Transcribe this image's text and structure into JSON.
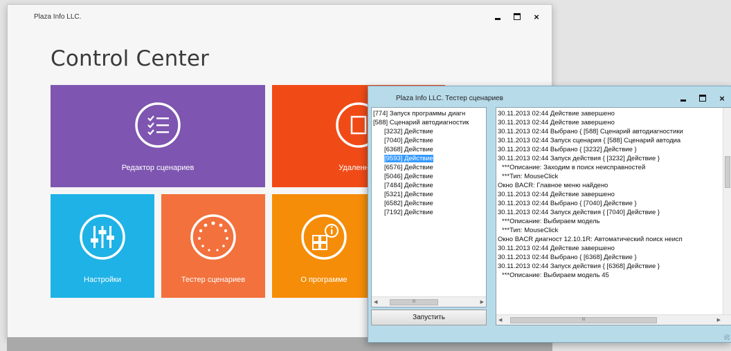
{
  "main_window": {
    "title": "Plaza Info LLC.",
    "app_title": "Control Center",
    "tiles": [
      {
        "id": "editor",
        "label": "Редактор сценариев",
        "color": "#7e55b0"
      },
      {
        "id": "remote",
        "label": "Удаленный",
        "color": "#f04b17"
      },
      {
        "id": "settings",
        "label": "Настройки",
        "color": "#1fb2e6"
      },
      {
        "id": "tester",
        "label": "Тестер сценариев",
        "color": "#f2713c"
      },
      {
        "id": "about",
        "label": "О программе",
        "color": "#f58d09"
      }
    ],
    "controls": {
      "close": "×"
    }
  },
  "tester_window": {
    "title": "Plaza Info LLC. Тестер сценариев",
    "controls": {
      "close": "×"
    },
    "tree": [
      {
        "text": "[774] Запуск программы диагн",
        "child": false,
        "selected": false
      },
      {
        "text": "[588] Сценарий автодиагностик",
        "child": false,
        "selected": false
      },
      {
        "text": "[3232] Действие",
        "child": true,
        "selected": false
      },
      {
        "text": "[7040] Действие",
        "child": true,
        "selected": false
      },
      {
        "text": "[6368] Действие",
        "child": true,
        "selected": false
      },
      {
        "text": "[9593] Действие",
        "child": true,
        "selected": true
      },
      {
        "text": "[6576] Действие",
        "child": true,
        "selected": false
      },
      {
        "text": "[5046] Действие",
        "child": true,
        "selected": false
      },
      {
        "text": "[7484] Действие",
        "child": true,
        "selected": false
      },
      {
        "text": "[5321] Действие",
        "child": true,
        "selected": false
      },
      {
        "text": "[6582] Действие",
        "child": true,
        "selected": false
      },
      {
        "text": "[7192] Действие",
        "child": true,
        "selected": false
      }
    ],
    "run_button": "Запустить",
    "log": [
      {
        "text": "30.11.2013 02:44 Действие завершено",
        "indent": false
      },
      {
        "text": "30.11.2013 02:44 Действие завершено",
        "indent": false
      },
      {
        "text": "30.11.2013 02:44 Выбрано { [588] Сценарий автодиагностики",
        "indent": false
      },
      {
        "text": "30.11.2013 02:44 Запуск сценария { [588] Сценарий автодиа",
        "indent": false
      },
      {
        "text": "30.11.2013 02:44 Выбрано { [3232] Действие }",
        "indent": false
      },
      {
        "text": "30.11.2013 02:44 Запуск действия { [3232] Действие }",
        "indent": false
      },
      {
        "text": "***Описание: Заходим в поиск неисправностей",
        "indent": true
      },
      {
        "text": "***Тип: MouseClick",
        "indent": true
      },
      {
        "text": "Окно BACR:  Главное меню найдено",
        "indent": false
      },
      {
        "text": "30.11.2013 02:44 Действие завершено",
        "indent": false
      },
      {
        "text": "30.11.2013 02:44 Выбрано { [7040] Действие }",
        "indent": false
      },
      {
        "text": "30.11.2013 02:44 Запуск действия { [7040] Действие }",
        "indent": false
      },
      {
        "text": "***Описание: Выбираем модель",
        "indent": true
      },
      {
        "text": "***Тип: MouseClick",
        "indent": true
      },
      {
        "text": "Окно BACR диагност 12.10.1R:  Автоматический поиск неисп",
        "indent": false
      },
      {
        "text": "30.11.2013 02:44 Действие завершено",
        "indent": false
      },
      {
        "text": "30.11.2013 02:44 Выбрано { [6368] Действие }",
        "indent": false
      },
      {
        "text": "30.11.2013 02:44 Запуск действия { [6368] Действие }",
        "indent": false
      },
      {
        "text": "***Описание: Выбираем модель 45",
        "indent": true
      }
    ],
    "scroll_glyph": "III"
  }
}
